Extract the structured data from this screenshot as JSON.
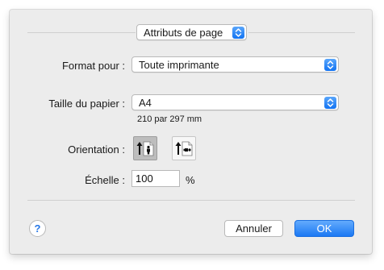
{
  "dialog": {
    "section_popup": {
      "value": "Attributs de page"
    },
    "format": {
      "label": "Format pour :",
      "value": "Toute imprimante"
    },
    "paper": {
      "label": "Taille du papier :",
      "value": "A4",
      "dimensions": "210 par 297 mm"
    },
    "orientation": {
      "label": "Orientation :",
      "options": [
        {
          "name": "portrait",
          "selected": true
        },
        {
          "name": "landscape",
          "selected": false
        }
      ]
    },
    "scale": {
      "label": "Échelle :",
      "value": "100",
      "unit": "%"
    },
    "help": {
      "label": "?"
    },
    "buttons": {
      "cancel": "Annuler",
      "ok": "OK"
    }
  },
  "colors": {
    "accent": "#1b78f3",
    "dialog_bg": "#ececec"
  },
  "icons": {
    "popup_arrows": "updown-chevron-icon",
    "portrait": "portrait-orientation-icon",
    "landscape": "landscape-orientation-icon",
    "help": "question-icon"
  }
}
